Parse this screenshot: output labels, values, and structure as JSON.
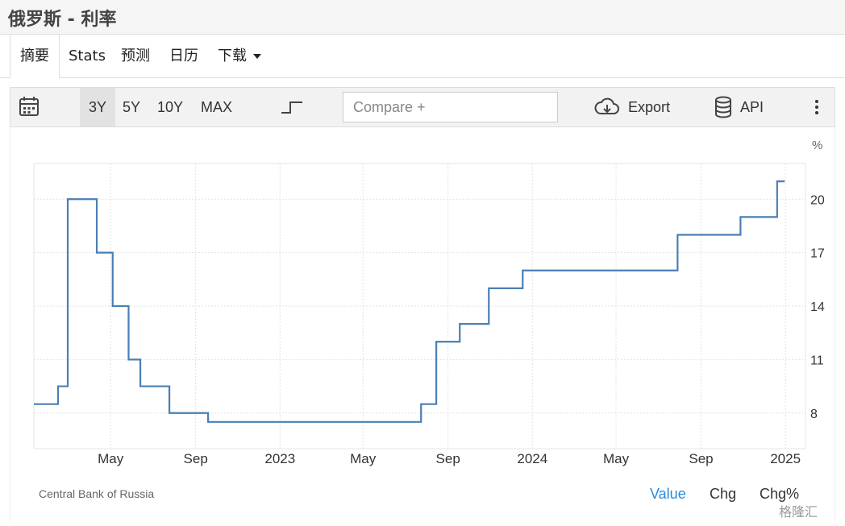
{
  "page": {
    "title": "俄罗斯 - 利率"
  },
  "tabs": [
    {
      "label": "摘要",
      "active": true
    },
    {
      "label": "Stats",
      "active": false
    },
    {
      "label": "预测",
      "active": false
    },
    {
      "label": "日历",
      "active": false
    },
    {
      "label": "下载",
      "active": false
    }
  ],
  "toolbar": {
    "ranges": [
      "3Y",
      "5Y",
      "10Y",
      "MAX"
    ],
    "selected_range": "3Y",
    "compare_placeholder": "Compare +",
    "export_label": "Export",
    "api_label": "API",
    "icons": [
      "calendar-icon",
      "step-line-icon",
      "cloud-download-icon",
      "database-icon",
      "more-vertical-icon"
    ]
  },
  "chart_data": {
    "type": "line",
    "step": true,
    "ylabel": "%",
    "ylim": [
      6,
      22
    ],
    "yticks": [
      8,
      11,
      14,
      17,
      20
    ],
    "xlim": [
      "2022-01-10",
      "2025-01-30"
    ],
    "xticks": [
      {
        "date": "2022-05-01",
        "label": "May"
      },
      {
        "date": "2022-09-01",
        "label": "Sep"
      },
      {
        "date": "2023-01-01",
        "label": "2023"
      },
      {
        "date": "2023-05-01",
        "label": "May"
      },
      {
        "date": "2023-09-01",
        "label": "Sep"
      },
      {
        "date": "2024-01-01",
        "label": "2024"
      },
      {
        "date": "2024-05-01",
        "label": "May"
      },
      {
        "date": "2024-09-01",
        "label": "Sep"
      },
      {
        "date": "2025-01-01",
        "label": "2025"
      }
    ],
    "series": [
      {
        "color": "#4a7fb5",
        "x": [
          "2022-01-10",
          "2022-02-14",
          "2022-02-28",
          "2022-04-11",
          "2022-05-04",
          "2022-05-27",
          "2022-06-13",
          "2022-07-25",
          "2022-09-19",
          "2023-07-24",
          "2023-08-15",
          "2023-09-18",
          "2023-10-30",
          "2023-12-18",
          "2024-07-29",
          "2024-10-28",
          "2024-12-20"
        ],
        "y": [
          8.5,
          9.5,
          20,
          17,
          14,
          11,
          9.5,
          8,
          7.5,
          8.5,
          12,
          13,
          15,
          16,
          18,
          19,
          21
        ]
      }
    ],
    "grid": true,
    "source": "Central Bank of Russia"
  },
  "footer": {
    "source": "Central Bank of Russia",
    "tabs": [
      "Value",
      "Chg",
      "Chg%"
    ],
    "active_tab": "Value"
  },
  "watermark": "格隆汇",
  "colors": {
    "accent": "#2a8ad9",
    "line": "#4a7fb5"
  }
}
